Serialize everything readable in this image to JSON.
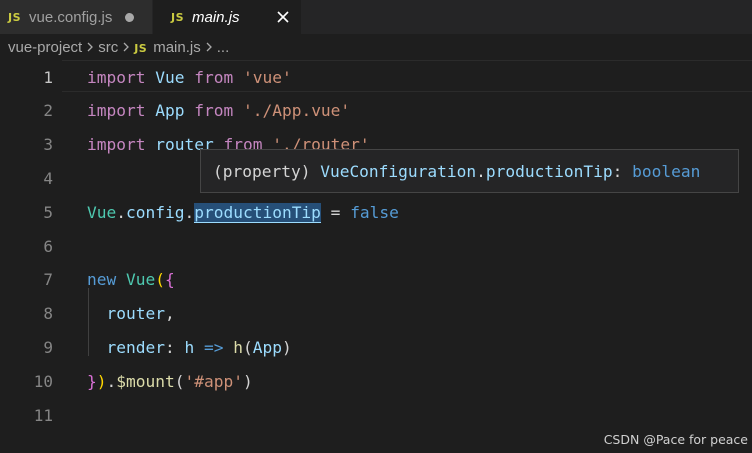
{
  "tabs": [
    {
      "badge": "JS",
      "label": "vue.config.js",
      "modified": true,
      "active": false
    },
    {
      "badge": "JS",
      "label": "main.js",
      "active": true,
      "close_icon": "close-icon"
    }
  ],
  "breadcrumb": {
    "segments": [
      "vue-project",
      "src",
      "main.js",
      "..."
    ],
    "file_badge": "JS",
    "separator_icon": "chevron-right-icon"
  },
  "editor": {
    "current_line": 1,
    "line_numbers": [
      "1",
      "2",
      "3",
      "4",
      "5",
      "6",
      "7",
      "8",
      "9",
      "10",
      "11"
    ],
    "lines": [
      [
        {
          "t": "import",
          "c": "kw"
        },
        {
          "t": " "
        },
        {
          "t": "Vue",
          "c": "var"
        },
        {
          "t": " "
        },
        {
          "t": "from",
          "c": "kw"
        },
        {
          "t": " "
        },
        {
          "t": "'vue'",
          "c": "str"
        }
      ],
      [
        {
          "t": "import",
          "c": "kw"
        },
        {
          "t": " "
        },
        {
          "t": "App",
          "c": "var"
        },
        {
          "t": " "
        },
        {
          "t": "from",
          "c": "kw"
        },
        {
          "t": " "
        },
        {
          "t": "'./App.vue'",
          "c": "str"
        }
      ],
      [
        {
          "t": "import",
          "c": "kw"
        },
        {
          "t": " "
        },
        {
          "t": "router",
          "c": "var"
        },
        {
          "t": " "
        },
        {
          "t": "from",
          "c": "kw"
        },
        {
          "t": " "
        },
        {
          "t": "'./router'",
          "c": "str"
        }
      ],
      [],
      [
        {
          "t": "Vue",
          "c": "cls"
        },
        {
          "t": "."
        },
        {
          "t": "config",
          "c": "var"
        },
        {
          "t": "."
        },
        {
          "t": "productionTip",
          "c": "var",
          "hl": true
        },
        {
          "t": " = "
        },
        {
          "t": "false",
          "c": "kw-blue"
        }
      ],
      [],
      [
        {
          "t": "new",
          "c": "kw-blue"
        },
        {
          "t": " "
        },
        {
          "t": "Vue",
          "c": "cls"
        },
        {
          "t": "(",
          "c": "brace1"
        },
        {
          "t": "{",
          "c": "brace2"
        }
      ],
      [
        {
          "t": "  "
        },
        {
          "t": "router",
          "c": "var"
        },
        {
          "t": ","
        }
      ],
      [
        {
          "t": "  "
        },
        {
          "t": "render",
          "c": "var"
        },
        {
          "t": ": "
        },
        {
          "t": "h",
          "c": "var"
        },
        {
          "t": " "
        },
        {
          "t": "=>",
          "c": "kw-blue"
        },
        {
          "t": " "
        },
        {
          "t": "h",
          "c": "fn"
        },
        {
          "t": "("
        },
        {
          "t": "App",
          "c": "var"
        },
        {
          "t": ")"
        }
      ],
      [
        {
          "t": "}",
          "c": "brace2"
        },
        {
          "t": ")",
          "c": "brace1"
        },
        {
          "t": "."
        },
        {
          "t": "$mount",
          "c": "fn"
        },
        {
          "t": "("
        },
        {
          "t": "'#app'",
          "c": "str"
        },
        {
          "t": ")"
        }
      ],
      []
    ]
  },
  "hover": {
    "segments": [
      {
        "t": "(property) "
      },
      {
        "t": "VueConfiguration",
        "c": "var"
      },
      {
        "t": "."
      },
      {
        "t": "productionTip",
        "c": "var"
      },
      {
        "t": ": "
      },
      {
        "t": "boolean",
        "c": "kw-blue"
      }
    ]
  },
  "watermark": "CSDN @Pace for peace",
  "colors": {
    "background": "#1e1e1e",
    "tabbar": "#252526",
    "keyword": "#c586c0",
    "identifier": "#9cdcfe",
    "class": "#4ec9b0",
    "string": "#ce9178",
    "function": "#dcdcaa",
    "constant": "#569cd6",
    "js_badge": "#cbcb41"
  }
}
